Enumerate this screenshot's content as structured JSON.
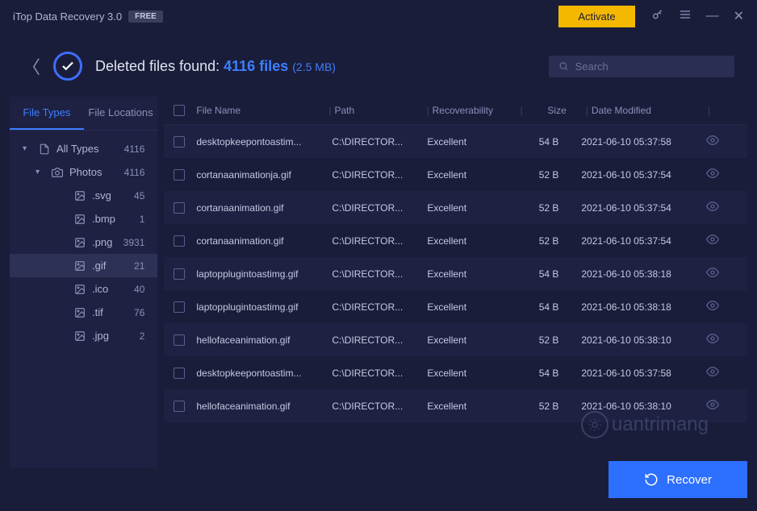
{
  "titlebar": {
    "app_name": "iTop Data Recovery 3.0",
    "badge": "FREE",
    "activate": "Activate"
  },
  "header": {
    "found_label": "Deleted files found:",
    "found_count": "4116",
    "found_unit": "files",
    "found_size": "(2.5 MB)",
    "search_placeholder": "Search"
  },
  "sidebar": {
    "tabs": [
      {
        "label": "File Types"
      },
      {
        "label": "File Locations"
      }
    ],
    "tree": [
      {
        "label": "All Types",
        "count": "4116",
        "indent": 0,
        "caret": "▾",
        "icon": "file"
      },
      {
        "label": "Photos",
        "count": "4116",
        "indent": 1,
        "caret": "▾",
        "icon": "camera"
      },
      {
        "label": ".svg",
        "count": "45",
        "indent": 2,
        "icon": "image"
      },
      {
        "label": ".bmp",
        "count": "1",
        "indent": 2,
        "icon": "image"
      },
      {
        "label": ".png",
        "count": "3931",
        "indent": 2,
        "icon": "image"
      },
      {
        "label": ".gif",
        "count": "21",
        "indent": 2,
        "icon": "image",
        "selected": true
      },
      {
        "label": ".ico",
        "count": "40",
        "indent": 2,
        "icon": "image"
      },
      {
        "label": ".tif",
        "count": "76",
        "indent": 2,
        "icon": "image"
      },
      {
        "label": ".jpg",
        "count": "2",
        "indent": 2,
        "icon": "image"
      }
    ]
  },
  "table": {
    "columns": {
      "name": "File Name",
      "path": "Path",
      "recov": "Recoverability",
      "size": "Size",
      "date": "Date Modified"
    },
    "rows": [
      {
        "name": "desktopkeepontoastim...",
        "path": "C:\\DIRECTOR...",
        "recov": "Excellent",
        "size": "54 B",
        "date": "2021-06-10 05:37:58"
      },
      {
        "name": "cortanaanimationja.gif",
        "path": "C:\\DIRECTOR...",
        "recov": "Excellent",
        "size": "52 B",
        "date": "2021-06-10 05:37:54"
      },
      {
        "name": "cortanaanimation.gif",
        "path": "C:\\DIRECTOR...",
        "recov": "Excellent",
        "size": "52 B",
        "date": "2021-06-10 05:37:54"
      },
      {
        "name": "cortanaanimation.gif",
        "path": "C:\\DIRECTOR...",
        "recov": "Excellent",
        "size": "52 B",
        "date": "2021-06-10 05:37:54"
      },
      {
        "name": "laptopplugintoastimg.gif",
        "path": "C:\\DIRECTOR...",
        "recov": "Excellent",
        "size": "54 B",
        "date": "2021-06-10 05:38:18"
      },
      {
        "name": "laptopplugintoastimg.gif",
        "path": "C:\\DIRECTOR...",
        "recov": "Excellent",
        "size": "54 B",
        "date": "2021-06-10 05:38:18"
      },
      {
        "name": "hellofaceanimation.gif",
        "path": "C:\\DIRECTOR...",
        "recov": "Excellent",
        "size": "52 B",
        "date": "2021-06-10 05:38:10"
      },
      {
        "name": "desktopkeepontoastim...",
        "path": "C:\\DIRECTOR...",
        "recov": "Excellent",
        "size": "54 B",
        "date": "2021-06-10 05:37:58"
      },
      {
        "name": "hellofaceanimation.gif",
        "path": "C:\\DIRECTOR...",
        "recov": "Excellent",
        "size": "52 B",
        "date": "2021-06-10 05:38:10"
      }
    ]
  },
  "footer": {
    "recover": "Recover"
  },
  "watermark": "uantrimang"
}
